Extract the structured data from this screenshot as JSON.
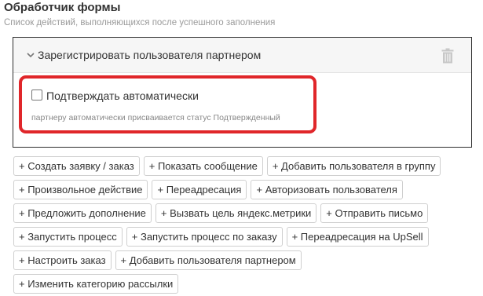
{
  "section": {
    "title": "Обработчик формы",
    "subtitle": "Список действий, выполняющихся после успешного заполнения"
  },
  "panel": {
    "title": "Зарегистрировать пользователя партнером",
    "checkbox": {
      "label": "Подтверждать автоматически",
      "checked": false
    },
    "hint": "партнеру автоматически присваивается статус Подтвержденный"
  },
  "colors": {
    "highlight": "#e0262a",
    "panel_border": "#2f2f2f",
    "header_bg": "#f6f6f6"
  },
  "actions": [
    [
      "+ Создать заявку / заказ",
      "+ Показать сообщение",
      "+ Добавить пользователя в группу"
    ],
    [
      "+ Произвольное действие",
      "+ Переадресация",
      "+ Авторизовать пользователя"
    ],
    [
      "+ Предложить дополнение",
      "+ Вызвать цель яндекс.метрики",
      "+ Отправить письмо"
    ],
    [
      "+ Запустить процесс",
      "+ Запустить процесс по заказу",
      "+ Переадресация на UpSell"
    ],
    [
      "+ Настроить заказ",
      "+ Добавить пользователя партнером"
    ],
    [
      "+ Изменить категорию рассылки"
    ]
  ]
}
